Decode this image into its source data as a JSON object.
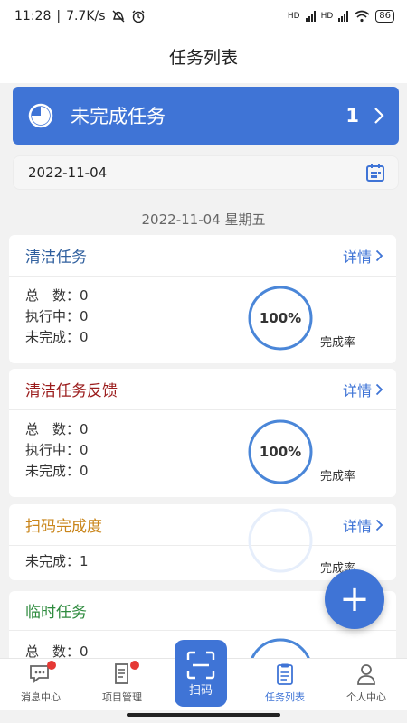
{
  "status": {
    "time": "11:28",
    "speed": "7.7K/s",
    "net_label": "HD",
    "battery": "86"
  },
  "header": {
    "title": "任务列表"
  },
  "banner": {
    "title": "未完成任务",
    "count": "1"
  },
  "date_picker": {
    "value": "2022-11-04"
  },
  "day": {
    "title": "2022-11-04 星期五"
  },
  "cards": [
    {
      "title": "清洁任务",
      "title_color": "#2f5f9e",
      "detail": "详情",
      "stats": [
        {
          "label": "总　数：",
          "value": "0"
        },
        {
          "label": "执行中：",
          "value": "0"
        },
        {
          "label": "未完成：",
          "value": "0"
        }
      ],
      "rate": "100%",
      "rate_label": "完成率",
      "rate_fraction": 1.0
    },
    {
      "title": "清洁任务反馈",
      "title_color": "#9b1c1c",
      "detail": "详情",
      "stats": [
        {
          "label": "总　数：",
          "value": "0"
        },
        {
          "label": "执行中：",
          "value": "0"
        },
        {
          "label": "未完成：",
          "value": "0"
        }
      ],
      "rate": "100%",
      "rate_label": "完成率",
      "rate_fraction": 1.0
    },
    {
      "title": "扫码完成度",
      "title_color": "#c9851a",
      "detail": "详情",
      "stats": [
        {
          "label": "未完成：",
          "value": "1"
        }
      ],
      "rate": "",
      "rate_label": "完成率",
      "rate_fraction": 0
    },
    {
      "title": "临时任务",
      "title_color": "#2e8b3e",
      "stats": [
        {
          "label": "总　数：",
          "value": "0"
        }
      ]
    }
  ],
  "fab": {
    "label": "+"
  },
  "tabs": [
    {
      "label": "消息中心",
      "badge": true
    },
    {
      "label": "项目管理",
      "badge": true
    },
    {
      "label": "扫码"
    },
    {
      "label": "任务列表",
      "active": true
    },
    {
      "label": "个人中心"
    }
  ],
  "colors": {
    "primary": "#3f74d6",
    "badge": "#e53935"
  }
}
